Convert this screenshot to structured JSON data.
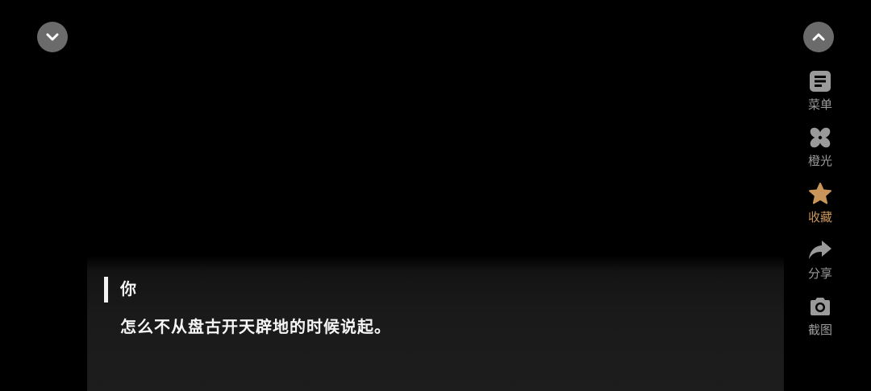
{
  "top_controls": {
    "collapse_icon": "chevron-down-icon",
    "expand_icon": "chevron-up-icon"
  },
  "side_menu": {
    "items": [
      {
        "label": "菜单",
        "icon": "menu-doc-icon",
        "color": "#9a9a9a"
      },
      {
        "label": "橙光",
        "icon": "pinwheel-icon",
        "color": "#9a9a9a"
      },
      {
        "label": "收藏",
        "icon": "star-icon",
        "color": "#c9955a"
      },
      {
        "label": "分享",
        "icon": "share-arrow-icon",
        "color": "#9a9a9a"
      },
      {
        "label": "截图",
        "icon": "camera-icon",
        "color": "#9a9a9a"
      }
    ]
  },
  "dialog": {
    "speaker": "你",
    "text": "怎么不从盘古开天辟地的时候说起。"
  },
  "colors": {
    "background": "#000000",
    "icon_gray": "#9a9a9a",
    "favorite_accent": "#c9955a",
    "dialog_text": "#f5f5f5",
    "round_button": "#6b6b6b"
  }
}
